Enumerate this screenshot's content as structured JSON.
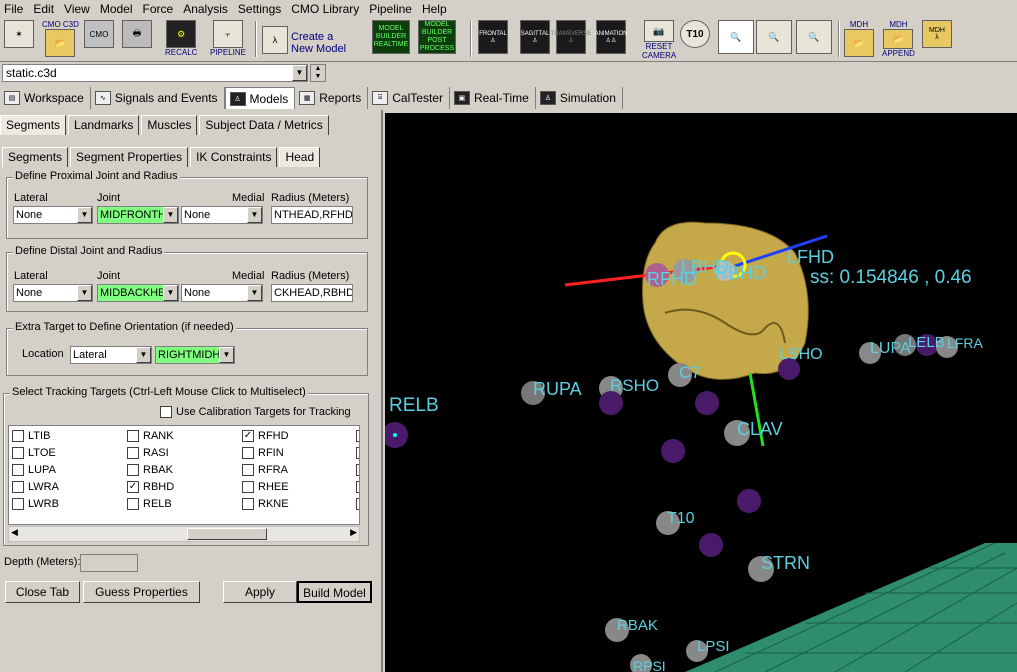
{
  "menu": [
    "File",
    "Edit",
    "View",
    "Model",
    "Force",
    "Analysis",
    "Settings",
    "CMO Library",
    "Pipeline",
    "Help"
  ],
  "toolbar": {
    "cmo_c3d": "CMO C3D",
    "cmo": "CMO",
    "recalc": "RECALC",
    "pipeline": "PIPELINE",
    "create_model_1": "Create a",
    "create_model_2": "New Model",
    "mb_realtime": "MODEL BUILDER REALTIME",
    "mb_post": "MODEL BUILDER POST PROCESS",
    "frontal": "FRONTAL",
    "sagittal": "SAGITTAL",
    "transverse": "TRANSVERSE",
    "animation": "ANIMATION",
    "reset_camera": "RESET CAMERA",
    "mdh": "MDH",
    "mdh2": "MDH",
    "append": "APPEND",
    "mdh3": "MDH",
    "t10": "T10"
  },
  "file": {
    "value": "static.c3d"
  },
  "main_tabs": [
    "Workspace",
    "Signals and Events",
    "Models",
    "Reports",
    "CalTester",
    "Real-Time",
    "Simulation"
  ],
  "top_tabs": [
    "Segments",
    "Landmarks",
    "Muscles",
    "Subject Data / Metrics"
  ],
  "sub_tabs": [
    "Segments",
    "Segment Properties",
    "IK Constraints",
    "Head"
  ],
  "proximal": {
    "title": "Define Proximal Joint and Radius",
    "lateral_label": "Lateral",
    "joint_label": "Joint",
    "medial_label": "Medial",
    "radius_label": "Radius (Meters)",
    "lateral": "None",
    "joint": "MIDFRONTH",
    "medial": "None",
    "radius": "NTHEAD,RFHD)"
  },
  "distal": {
    "title": "Define Distal Joint and Radius",
    "lateral_label": "Lateral",
    "joint_label": "Joint",
    "medial_label": "Medial",
    "radius_label": "Radius (Meters)",
    "lateral": "None",
    "joint": "MIDBACKHE",
    "medial": "None",
    "radius": "CKHEAD,RBHD)"
  },
  "extra": {
    "title": "Extra Target to Define Orientation (if needed)",
    "location_label": "Location",
    "location": "Lateral",
    "target": "RIGHTMIDH"
  },
  "tracking": {
    "title": "Select Tracking Targets (Ctrl-Left Mouse Click to Multiselect)",
    "use_cal": "Use Calibration Targets for Tracking",
    "col1": [
      "LTIB",
      "LTOE",
      "LUPA",
      "LWRA",
      "LWRB"
    ],
    "col2": [
      "RANK",
      "RASI",
      "RBAK",
      "RBHD",
      "RELB"
    ],
    "col3": [
      "RFHD",
      "RFIN",
      "RFRA",
      "RHEE",
      "RKNE"
    ]
  },
  "depth_label": "Depth (Meters):",
  "buttons": {
    "close_tab": "Close Tab",
    "guess": "Guess Properties",
    "apply": "Apply",
    "build": "Build Model"
  },
  "viewer": {
    "markers": [
      "RELB",
      "RUPA",
      "RSHO",
      "C7",
      "CLAV",
      "LSHO",
      "LUPA",
      "LELB",
      "LFRA",
      "T10",
      "STRN",
      "RBAK",
      "LPSI",
      "RPSI",
      "LFHD"
    ],
    "overlay1": "RFHD",
    "overlay2": "LBHD",
    "overlay3": "RBHD",
    "mass_text": "ss:  0.154846  ,  0.46"
  }
}
